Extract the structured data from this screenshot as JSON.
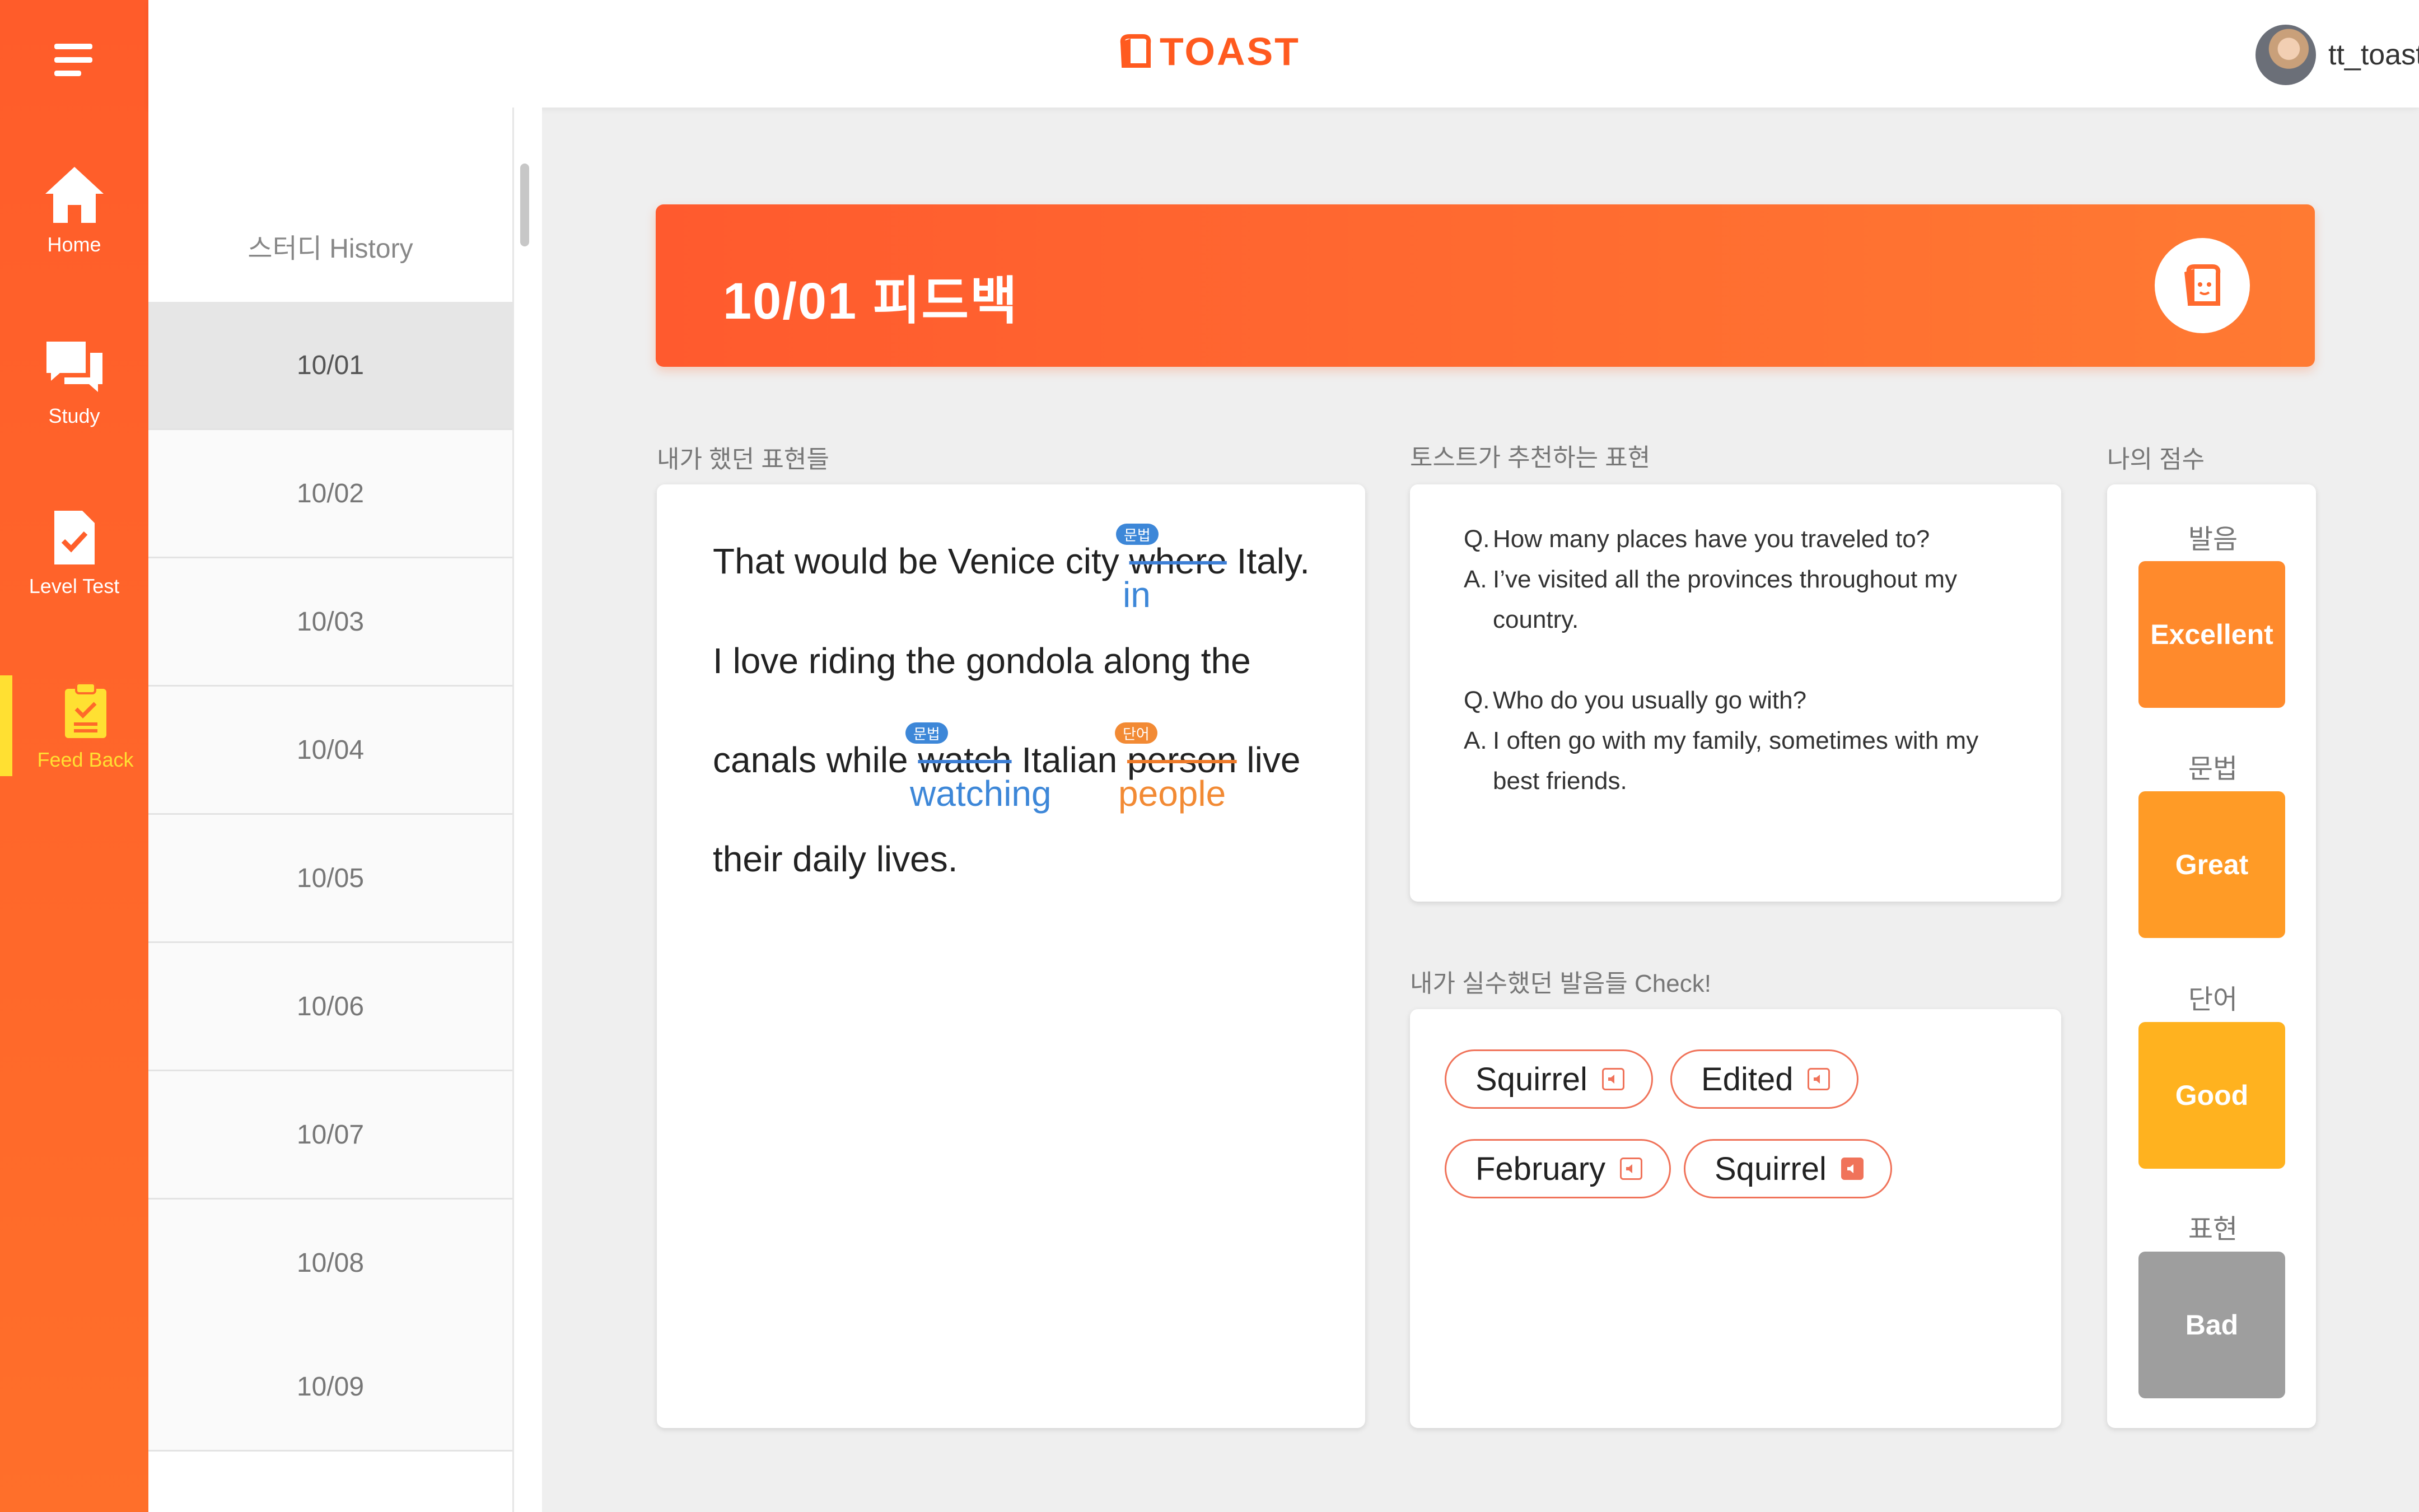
{
  "app": {
    "logo_text": "TOAST"
  },
  "user": {
    "name": "tt_toaster"
  },
  "nav": {
    "items": [
      {
        "label": "Home",
        "icon": "home-icon"
      },
      {
        "label": "Study",
        "icon": "chat-icon"
      },
      {
        "label": "Level Test",
        "icon": "document-check-icon"
      },
      {
        "label": "Feed Back",
        "icon": "clipboard-check-icon",
        "active": true
      }
    ]
  },
  "history": {
    "title": "스터디 History",
    "dates": [
      "10/01",
      "10/02",
      "10/03",
      "10/04",
      "10/05",
      "10/06",
      "10/07",
      "10/08",
      "10/09"
    ],
    "selected": "10/01"
  },
  "banner": {
    "title": "10/01  피드백"
  },
  "my_expressions": {
    "label": "내가 했던 표현들",
    "line1": {
      "before": "That  would be Venice city ",
      "wrong": "where",
      "after": " Italy.",
      "tag": "문법",
      "correction": "in"
    },
    "line2": "I love riding the gondola along the",
    "line3": {
      "start": "canals while ",
      "wrong1": "watch",
      "mid": " Italian ",
      "wrong2": "person",
      "end": " live",
      "tag1": "문법",
      "correction1": "watching",
      "tag2": "단어",
      "correction2": "people"
    },
    "line4": "their daily lives."
  },
  "recommended": {
    "label": "토스트가 추천하는 표현",
    "qa": [
      {
        "q_key": "Q.",
        "q": "How many places have you traveled to?",
        "a_key": "A.",
        "a": "I’ve visited all the provinces throughout my country."
      },
      {
        "q_key": "Q.",
        "q": "Who do you usually go with?",
        "a_key": "A.",
        "a": "I often go with my family, sometimes with my best friends."
      }
    ]
  },
  "pronunciation": {
    "label": "내가 실수했던 발음들 Check!",
    "words": [
      "Squirrel",
      "Edited",
      "February",
      "Squirrel"
    ]
  },
  "scores": {
    "label": "나의 점수",
    "items": [
      {
        "category": "발음",
        "grade": "Excellent",
        "color": "#ff8a2c"
      },
      {
        "category": "문법",
        "grade": "Great",
        "color": "#ff9b26"
      },
      {
        "category": "단어",
        "grade": "Good",
        "color": "#ffb21f"
      },
      {
        "category": "표현",
        "grade": "Bad",
        "color": "#9e9e9e"
      }
    ]
  },
  "colors": {
    "accent": "#ff5a1f",
    "grammar_tag": "#3d87d8",
    "word_tag": "#f28a34",
    "active_nav": "#ffe032"
  }
}
